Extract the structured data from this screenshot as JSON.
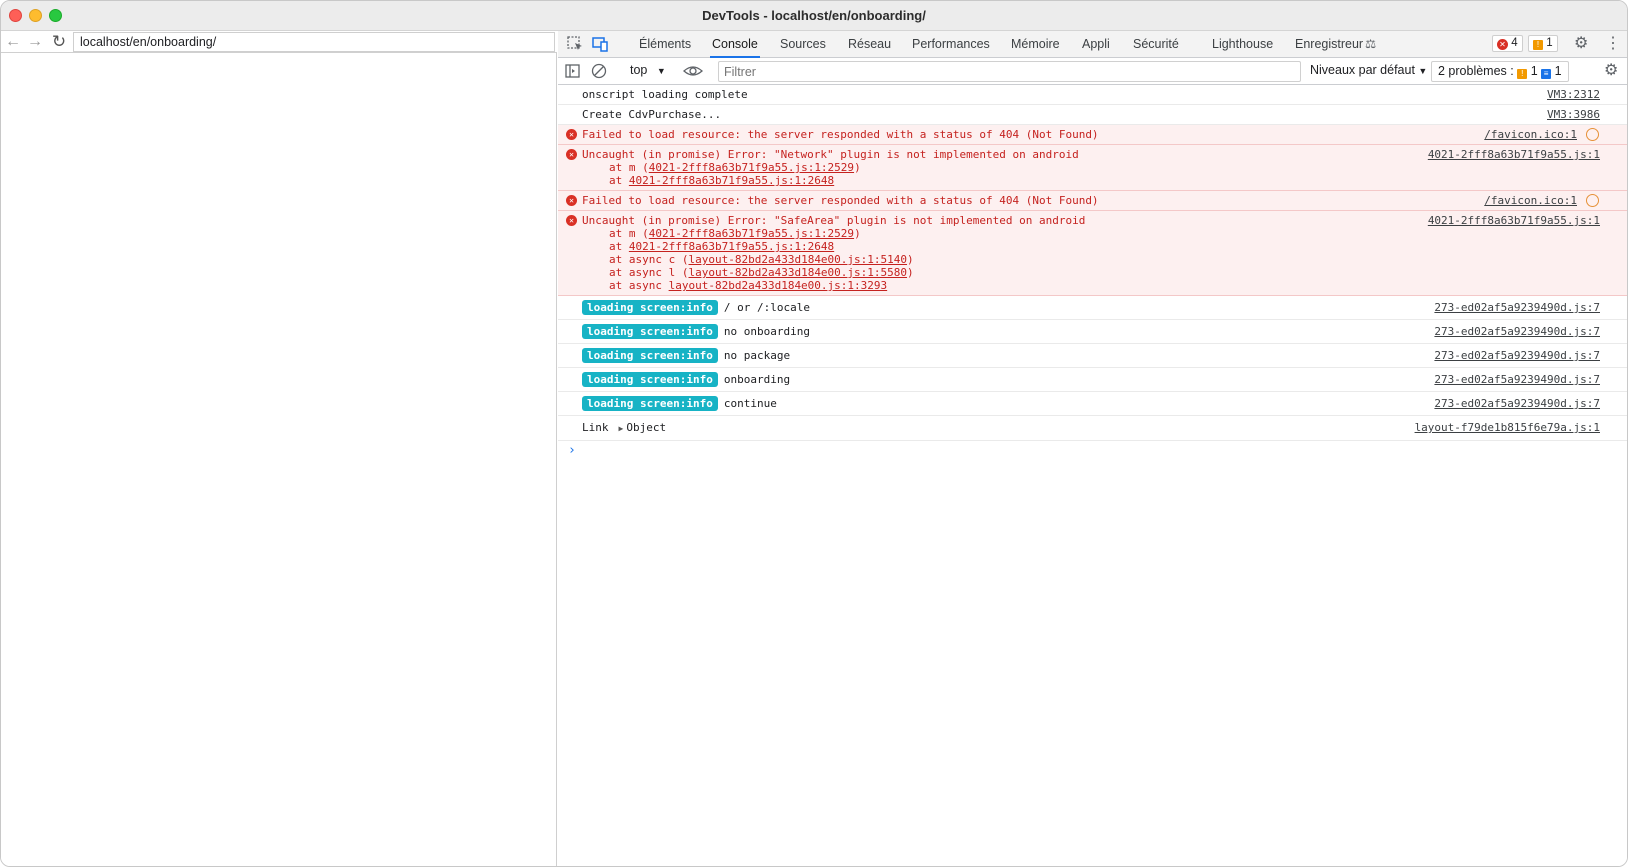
{
  "window": {
    "title": "DevTools - localhost/en/onboarding/"
  },
  "browser": {
    "url": "localhost/en/onboarding/"
  },
  "devtools": {
    "tabs": [
      "Éléments",
      "Console",
      "Sources",
      "Réseau",
      "Performances",
      "Mémoire",
      "Appli",
      "Sécurité",
      "Lighthouse",
      "Enregistreur"
    ],
    "active_tab": "Console",
    "error_count": "4",
    "warning_count": "1",
    "context": "top",
    "filter_placeholder": "Filtrer",
    "levels": "Niveaux par défaut",
    "problems_label": "2 problèmes :",
    "problems_warn": "1",
    "problems_info": "1"
  },
  "console": {
    "logs": [
      {
        "text": "onscript loading complete",
        "src": "VM3:2312"
      },
      {
        "text": "Create CdvPurchase...",
        "src": "VM3:3986"
      }
    ],
    "errors": [
      {
        "text": "Failed to load resource: the server responded with a status of 404 (Not Found)",
        "src": "/favicon.ico:1"
      },
      {
        "text": "Uncaught (in promise) Error: \"Network\" plugin is not implemented on android",
        "src": "4021-2fff8a63b71f9a55.js:1",
        "stack": [
          {
            "prefix": "at m (",
            "link": "4021-2fff8a63b71f9a55.js:1:2529",
            "suffix": ")"
          },
          {
            "prefix": "at ",
            "link": "4021-2fff8a63b71f9a55.js:1:2648",
            "suffix": ""
          }
        ]
      },
      {
        "text": "Failed to load resource: the server responded with a status of 404 (Not Found)",
        "src": "/favicon.ico:1"
      },
      {
        "text": "Uncaught (in promise) Error: \"SafeArea\" plugin is not implemented on android",
        "src": "4021-2fff8a63b71f9a55.js:1",
        "stack": [
          {
            "prefix": "at m (",
            "link": "4021-2fff8a63b71f9a55.js:1:2529",
            "suffix": ")"
          },
          {
            "prefix": "at ",
            "link": "4021-2fff8a63b71f9a55.js:1:2648",
            "suffix": ""
          },
          {
            "prefix": "at async c (",
            "link": "layout-82bd2a433d184e00.js:1:5140",
            "suffix": ")"
          },
          {
            "prefix": "at async l (",
            "link": "layout-82bd2a433d184e00.js:1:5580",
            "suffix": ")"
          },
          {
            "prefix": "at async ",
            "link": "layout-82bd2a433d184e00.js:1:3293",
            "suffix": ""
          }
        ]
      }
    ],
    "info_tag": "loading screen:info",
    "infos": [
      {
        "text": "/ or /:locale",
        "src": "273-ed02af5a9239490d.js:7"
      },
      {
        "text": "no onboarding",
        "src": "273-ed02af5a9239490d.js:7"
      },
      {
        "text": "no package",
        "src": "273-ed02af5a9239490d.js:7"
      },
      {
        "text": "onboarding",
        "src": "273-ed02af5a9239490d.js:7"
      },
      {
        "text": "continue",
        "src": "273-ed02af5a9239490d.js:7"
      }
    ],
    "link_row": {
      "label": "Link",
      "object": "Object",
      "src": "layout-f79de1b815f6e79a.js:1"
    }
  }
}
